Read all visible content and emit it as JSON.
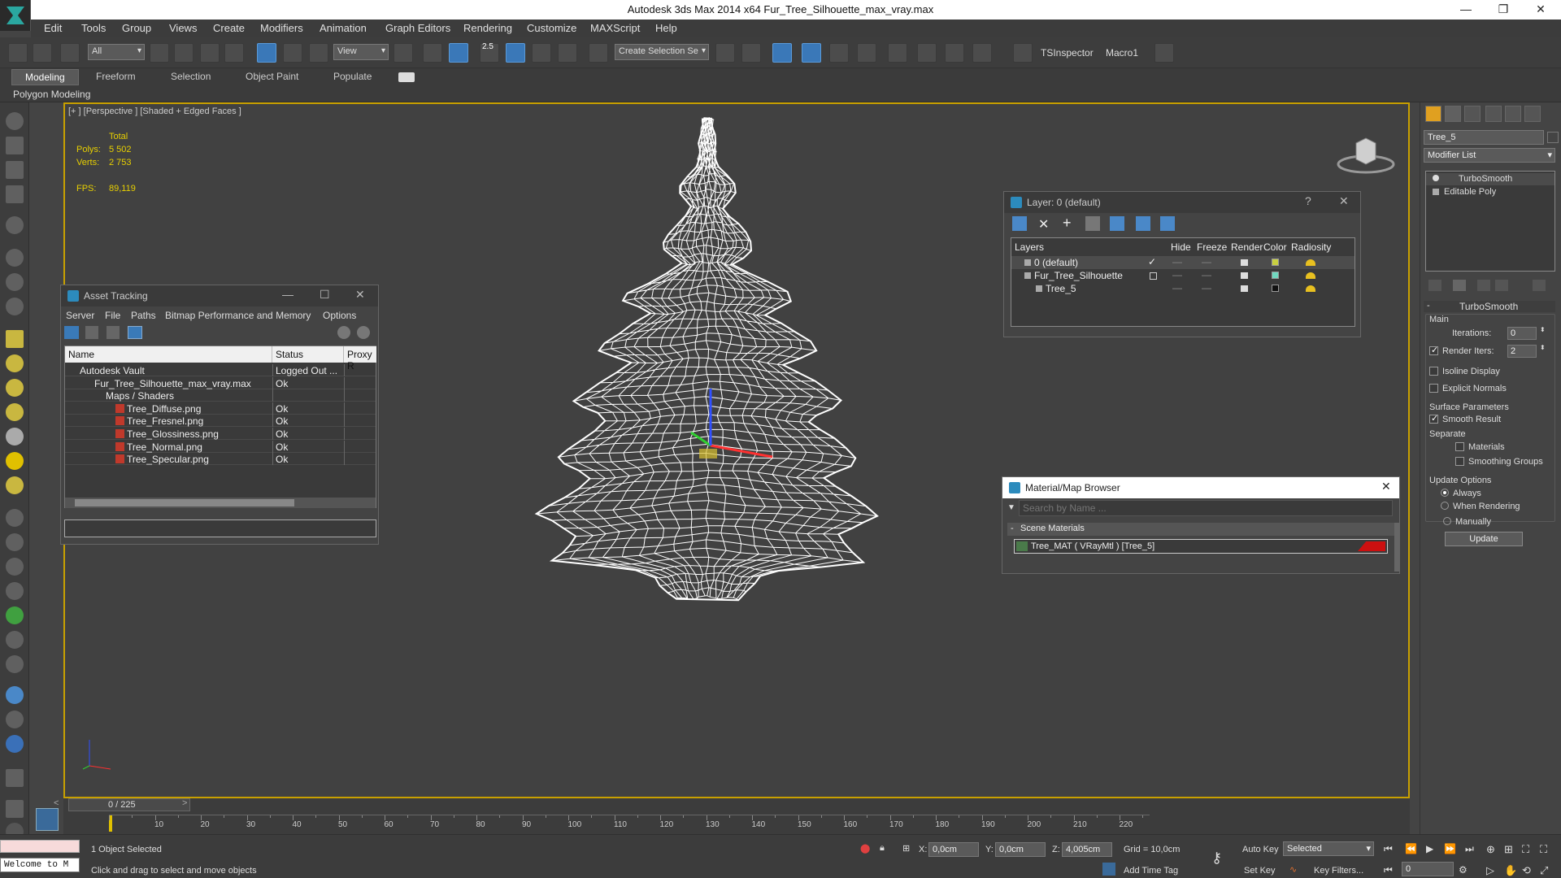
{
  "window": {
    "title": "Autodesk 3ds Max  2014 x64     Fur_Tree_Silhouette_max_vray.max"
  },
  "menu": [
    "Edit",
    "Tools",
    "Group",
    "Views",
    "Create",
    "Modifiers",
    "Animation",
    "Graph Editors",
    "Rendering",
    "Customize",
    "MAXScript",
    "Help"
  ],
  "toolbar": {
    "filter": "All",
    "ref_coord": "View",
    "selection_set": "Create Selection Se",
    "angle_snap": "2.5",
    "plugin1": "TSInspector",
    "plugin2": "Macro1"
  },
  "ribbon": {
    "tabs": [
      "Modeling",
      "Freeform",
      "Selection",
      "Object Paint",
      "Populate"
    ],
    "active": "Modeling",
    "sub": "Polygon Modeling"
  },
  "viewport": {
    "label": "[+ ] [Perspective ] [Shaded + Edged Faces ]",
    "stats": {
      "total_label": "Total",
      "polys_label": "Polys:",
      "polys": "5 502",
      "verts_label": "Verts:",
      "verts": "2 753",
      "fps_label": "FPS:",
      "fps": "89,119"
    },
    "mesh_color": "#ffffff",
    "gizmo": {
      "x_color": "#ff3030",
      "y_color": "#30d030",
      "z_color": "#3050ff"
    }
  },
  "asset_tracking": {
    "title": "Asset Tracking",
    "menu": [
      "Server",
      "File",
      "Paths",
      "Bitmap Performance and Memory",
      "Options"
    ],
    "columns": [
      "Name",
      "Status",
      "Proxy R"
    ],
    "rows": [
      {
        "name": "Autodesk Vault",
        "status": "Logged Out ..."
      },
      {
        "name": "Fur_Tree_Silhouette_max_vray.max",
        "status": "Ok"
      },
      {
        "name": "Maps / Shaders",
        "status": ""
      },
      {
        "name": "Tree_Diffuse.png",
        "status": "Ok"
      },
      {
        "name": "Tree_Fresnel.png",
        "status": "Ok"
      },
      {
        "name": "Tree_Glossiness.png",
        "status": "Ok"
      },
      {
        "name": "Tree_Normal.png",
        "status": "Ok"
      },
      {
        "name": "Tree_Specular.png",
        "status": "Ok"
      }
    ]
  },
  "layer_manager": {
    "title": "Layer: 0 (default)",
    "help": "?",
    "columns": [
      "Layers",
      "Hide",
      "Freeze",
      "Render",
      "Color",
      "Radiosity"
    ],
    "rows": [
      {
        "name": "0 (default)",
        "color": "#c8d040"
      },
      {
        "name": "Fur_Tree_Silhouette",
        "color": "#70d8c0"
      },
      {
        "name": "Tree_5",
        "color": "#111111"
      }
    ]
  },
  "material_browser": {
    "title": "Material/Map Browser",
    "search_placeholder": "Search by Name ...",
    "group": "Scene Materials",
    "item": "Tree_MAT  ( VRayMtl )  [Tree_5]",
    "swatch": "#cc1010"
  },
  "command_panel": {
    "object_name": "Tree_5",
    "modifier_list": "Modifier List",
    "stack": [
      "TurboSmooth",
      "Editable Poly"
    ],
    "rollout": "TurboSmooth",
    "main": "Main",
    "iterations_label": "Iterations:",
    "iterations": "0",
    "render_iters_label": "Render Iters:",
    "render_iters": "2",
    "isoline": "Isoline Display",
    "explicit_normals": "Explicit Normals",
    "surface_params": "Surface Parameters",
    "smooth_result": "Smooth Result",
    "separate": "Separate",
    "materials": "Materials",
    "smoothing_groups": "Smoothing Groups",
    "update_options": "Update Options",
    "always": "Always",
    "when_rendering": "When Rendering",
    "manually": "Manually",
    "update_btn": "Update"
  },
  "timeline": {
    "frame": "0 / 225",
    "ticks": [
      "10",
      "20",
      "30",
      "40",
      "50",
      "60",
      "70",
      "80",
      "90",
      "100",
      "110",
      "120",
      "130",
      "140",
      "150",
      "160",
      "170",
      "180",
      "190",
      "200",
      "210",
      "220"
    ]
  },
  "status": {
    "welcome": "Welcome to M",
    "selected": "1 Object Selected",
    "prompt": "Click and drag to select and move objects",
    "x_label": "X:",
    "x": "0,0cm",
    "y_label": "Y:",
    "y": "0,0cm",
    "z_label": "Z:",
    "z": "4,005cm",
    "grid": "Grid = 10,0cm",
    "add_time_tag": "Add Time Tag",
    "auto_key": "Auto Key",
    "set_key": "Set Key",
    "key_mode": "Selected",
    "key_filters": "Key Filters...",
    "frame": "0"
  }
}
